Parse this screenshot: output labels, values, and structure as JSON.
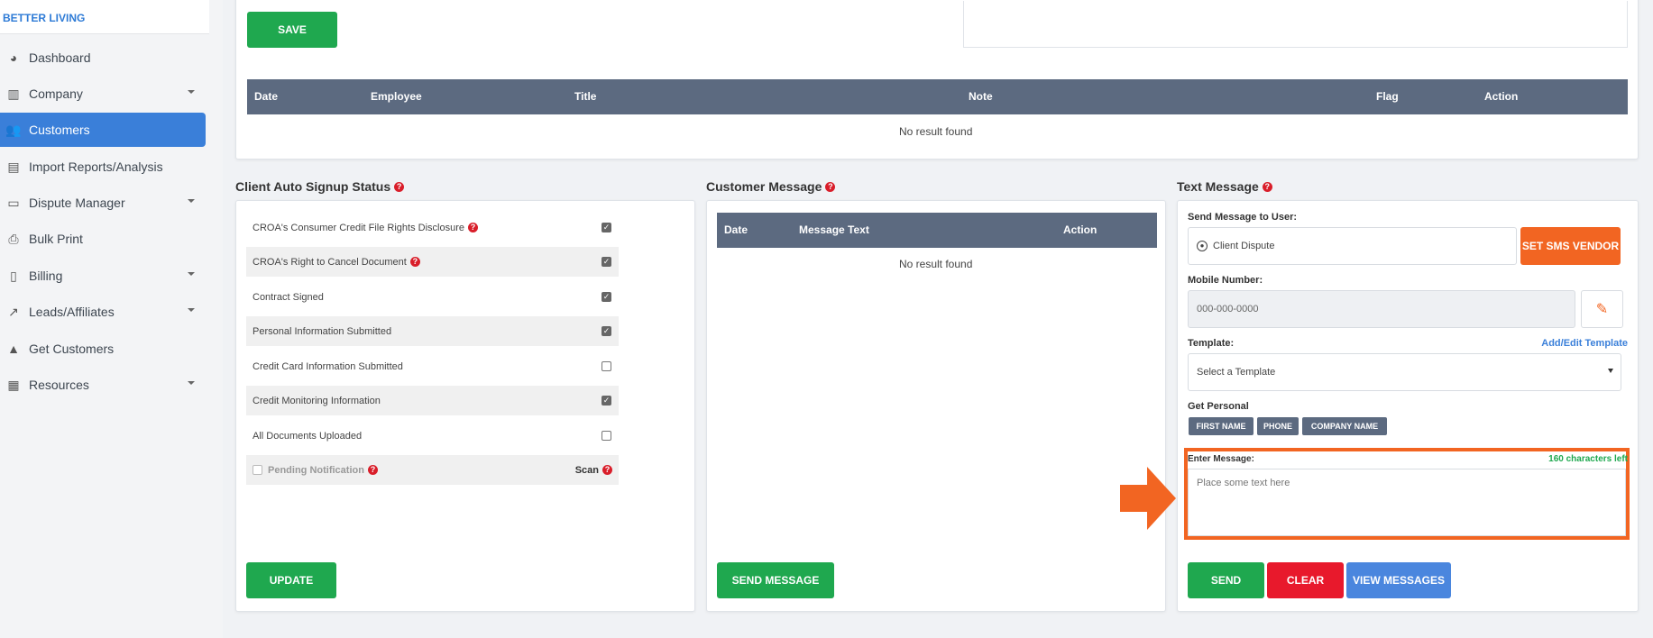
{
  "brand": "BETTER LIVING",
  "sidebar": {
    "items": [
      {
        "label": "Dashboard",
        "icon": "pie-chart-icon"
      },
      {
        "label": "Company",
        "icon": "building-icon"
      },
      {
        "label": "Customers",
        "icon": "users-icon"
      },
      {
        "label": "Import Reports/Analysis",
        "icon": "file-import-icon"
      },
      {
        "label": "Dispute Manager",
        "icon": "laptop-icon"
      },
      {
        "label": "Bulk Print",
        "icon": "printer-icon"
      },
      {
        "label": "Billing",
        "icon": "invoice-icon"
      },
      {
        "label": "Leads/Affiliates",
        "icon": "line-chart-icon"
      },
      {
        "label": "Get Customers",
        "icon": "graduation-cap-icon"
      },
      {
        "label": "Resources",
        "icon": "boxes-icon"
      }
    ]
  },
  "notes": {
    "save_label": "SAVE",
    "columns": [
      "Date",
      "Employee",
      "Title",
      "Note",
      "Flag",
      "Action"
    ],
    "empty_text": "No result found"
  },
  "auto_signup": {
    "title": "Client Auto Signup Status",
    "rows": [
      {
        "label": "CROA's Consumer Credit File Rights Disclosure",
        "checked": true,
        "help": true
      },
      {
        "label": "CROA's Right to Cancel Document",
        "checked": true,
        "help": true
      },
      {
        "label": "Contract Signed",
        "checked": true,
        "help": false
      },
      {
        "label": "Personal Information Submitted",
        "checked": true,
        "help": false
      },
      {
        "label": "Credit Card Information Submitted",
        "checked": false,
        "help": false
      },
      {
        "label": "Credit Monitoring Information",
        "checked": true,
        "help": false
      },
      {
        "label": "All Documents Uploaded",
        "checked": false,
        "help": false
      }
    ],
    "pending_label": "Pending Notification",
    "scan_label": "Scan",
    "update_label": "UPDATE"
  },
  "customer_message": {
    "title": "Customer Message",
    "columns": [
      "Date",
      "Message Text",
      "Action"
    ],
    "empty_text": "No result found",
    "send_label": "SEND MESSAGE"
  },
  "text_message": {
    "title": "Text Message",
    "send_to_label": "Send Message to User:",
    "send_to_value": "Client Dispute",
    "sms_vendor_label": "SET SMS VENDOR",
    "mobile_label": "Mobile Number:",
    "mobile_placeholder": "000-000-0000",
    "template_label": "Template:",
    "template_link": "Add/Edit Template",
    "template_value": "Select a Template",
    "personal_label": "Get Personal",
    "chips": [
      "FIRST NAME",
      "PHONE",
      "COMPANY NAME"
    ],
    "enter_label": "Enter Message:",
    "chars_left": "160 characters left",
    "message_placeholder": "Place some text here",
    "send_label": "SEND",
    "clear_label": "CLEAR",
    "view_label": "VIEW MESSAGES"
  },
  "colors": {
    "accent_blue": "#3a7fd9",
    "green": "#1fa84f",
    "red": "#e8192c",
    "orange": "#f26522",
    "table_header": "#5c6a80"
  }
}
